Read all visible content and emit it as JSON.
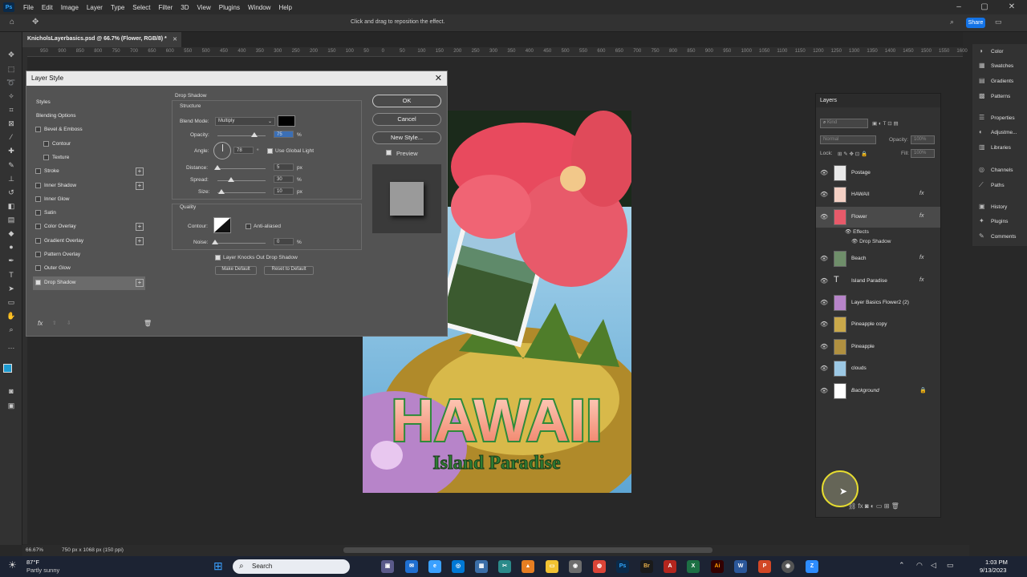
{
  "app": {
    "logo": "Ps",
    "menu": [
      "File",
      "Edit",
      "Image",
      "Layer",
      "Type",
      "Select",
      "Filter",
      "3D",
      "View",
      "Plugins",
      "Window",
      "Help"
    ],
    "options_hint": "Click and drag to reposition the effect.",
    "share_label": "Share",
    "doc_tab": "KnicholsLayerbasics.psd @ 66.7% (Flower, RGB/8) *",
    "ruler_labels": [
      "950",
      "900",
      "850",
      "800",
      "750",
      "700",
      "650",
      "600",
      "550",
      "500",
      "450",
      "400",
      "350",
      "300",
      "250",
      "200",
      "150",
      "100",
      "50",
      "0",
      "50",
      "100",
      "150",
      "200",
      "250",
      "300",
      "350",
      "400",
      "450",
      "500",
      "550",
      "600",
      "650",
      "700",
      "750",
      "800",
      "850",
      "900",
      "950",
      "1000",
      "1050",
      "1100",
      "1150",
      "1200",
      "1250",
      "1300",
      "1350",
      "1400",
      "1450",
      "1500",
      "1550",
      "1600",
      "1650"
    ]
  },
  "dialog": {
    "title": "Layer Style",
    "styles_header": "Styles",
    "style_rows": [
      {
        "label": "Blending Options",
        "checkbox": false,
        "plus": false,
        "checked": false
      },
      {
        "label": "Bevel & Emboss",
        "checkbox": true,
        "plus": false,
        "checked": false
      },
      {
        "label": "Contour",
        "checkbox": true,
        "plus": false,
        "checked": false,
        "indent": true
      },
      {
        "label": "Texture",
        "checkbox": true,
        "plus": false,
        "checked": false,
        "indent": true
      },
      {
        "label": "Stroke",
        "checkbox": true,
        "plus": true,
        "checked": false
      },
      {
        "label": "Inner Shadow",
        "checkbox": true,
        "plus": true,
        "checked": false
      },
      {
        "label": "Inner Glow",
        "checkbox": true,
        "plus": false,
        "checked": false
      },
      {
        "label": "Satin",
        "checkbox": true,
        "plus": false,
        "checked": false
      },
      {
        "label": "Color Overlay",
        "checkbox": true,
        "plus": true,
        "checked": false
      },
      {
        "label": "Gradient Overlay",
        "checkbox": true,
        "plus": true,
        "checked": false
      },
      {
        "label": "Pattern Overlay",
        "checkbox": true,
        "plus": false,
        "checked": false
      },
      {
        "label": "Outer Glow",
        "checkbox": true,
        "plus": false,
        "checked": false
      },
      {
        "label": "Drop Shadow",
        "checkbox": true,
        "plus": true,
        "checked": true,
        "selected": true
      }
    ],
    "section_title": "Drop Shadow",
    "structure_title": "Structure",
    "blend_mode_label": "Blend Mode:",
    "blend_mode_value": "Multiply",
    "opacity_label": "Opacity:",
    "opacity_value": "75",
    "opacity_unit": "%",
    "angle_label": "Angle:",
    "angle_value": "78",
    "angle_unit": "°",
    "global_light_label": "Use Global Light",
    "distance_label": "Distance:",
    "distance_value": "5",
    "distance_unit": "px",
    "spread_label": "Spread:",
    "spread_value": "30",
    "spread_unit": "%",
    "size_label": "Size:",
    "size_value": "10",
    "size_unit": "px",
    "quality_title": "Quality",
    "contour_label": "Contour:",
    "anti_aliased_label": "Anti-aliased",
    "noise_label": "Noise:",
    "noise_value": "0",
    "noise_unit": "%",
    "knockout_label": "Layer Knocks Out Drop Shadow",
    "make_default_label": "Make Default",
    "reset_default_label": "Reset to Default",
    "ok_label": "OK",
    "cancel_label": "Cancel",
    "new_style_label": "New Style...",
    "preview_label": "Preview",
    "fx_label": "fx"
  },
  "artwork": {
    "headline": "HAWAII",
    "subline": "Island Paradise"
  },
  "layers": {
    "title": "Layers",
    "kind_placeholder": "Kind",
    "blend_mode": "Normal",
    "opacity_label": "Opacity:",
    "opacity_value": "100%",
    "lock_label": "Lock:",
    "fill_label": "Fill:",
    "fill_value": "100%",
    "rows": [
      {
        "name": "Postage",
        "fx": false
      },
      {
        "name": "HAWAII",
        "fx": true
      },
      {
        "name": "Flower",
        "fx": true,
        "selected": true
      },
      {
        "name": "Beach",
        "fx": true
      },
      {
        "name": "Island Paradise",
        "fx": true,
        "text": true
      },
      {
        "name": "Layer Basics Flower2 (2)",
        "fx": false
      },
      {
        "name": "Pineapple copy",
        "fx": false
      },
      {
        "name": "Pineapple",
        "fx": false
      },
      {
        "name": "clouds",
        "fx": false
      },
      {
        "name": "Background",
        "fx": false,
        "locked": true
      }
    ],
    "effects_label": "Effects",
    "drop_shadow_label": "Drop Shadow"
  },
  "dock": [
    {
      "label": "Color",
      "icon": "color-icon"
    },
    {
      "label": "Swatches",
      "icon": "swatches-icon"
    },
    {
      "label": "Gradients",
      "icon": "gradients-icon"
    },
    {
      "label": "Patterns",
      "icon": "patterns-icon"
    },
    {
      "label": "Properties",
      "icon": "properties-icon"
    },
    {
      "label": "Adjustme...",
      "icon": "adjustments-icon"
    },
    {
      "label": "Libraries",
      "icon": "libraries-icon"
    },
    {
      "label": "Channels",
      "icon": "channels-icon"
    },
    {
      "label": "Paths",
      "icon": "paths-icon"
    },
    {
      "label": "History",
      "icon": "history-icon"
    },
    {
      "label": "Plugins",
      "icon": "plugins-icon"
    },
    {
      "label": "Comments",
      "icon": "comments-icon"
    }
  ],
  "status": {
    "zoom": "66.67%",
    "doc_info": "750 px x 1068 px (150 ppi)"
  },
  "taskbar": {
    "weather_temp": "87°F",
    "weather_desc": "Partly sunny",
    "search_label": "Search",
    "time": "1:03 PM",
    "date": "9/13/2023"
  }
}
